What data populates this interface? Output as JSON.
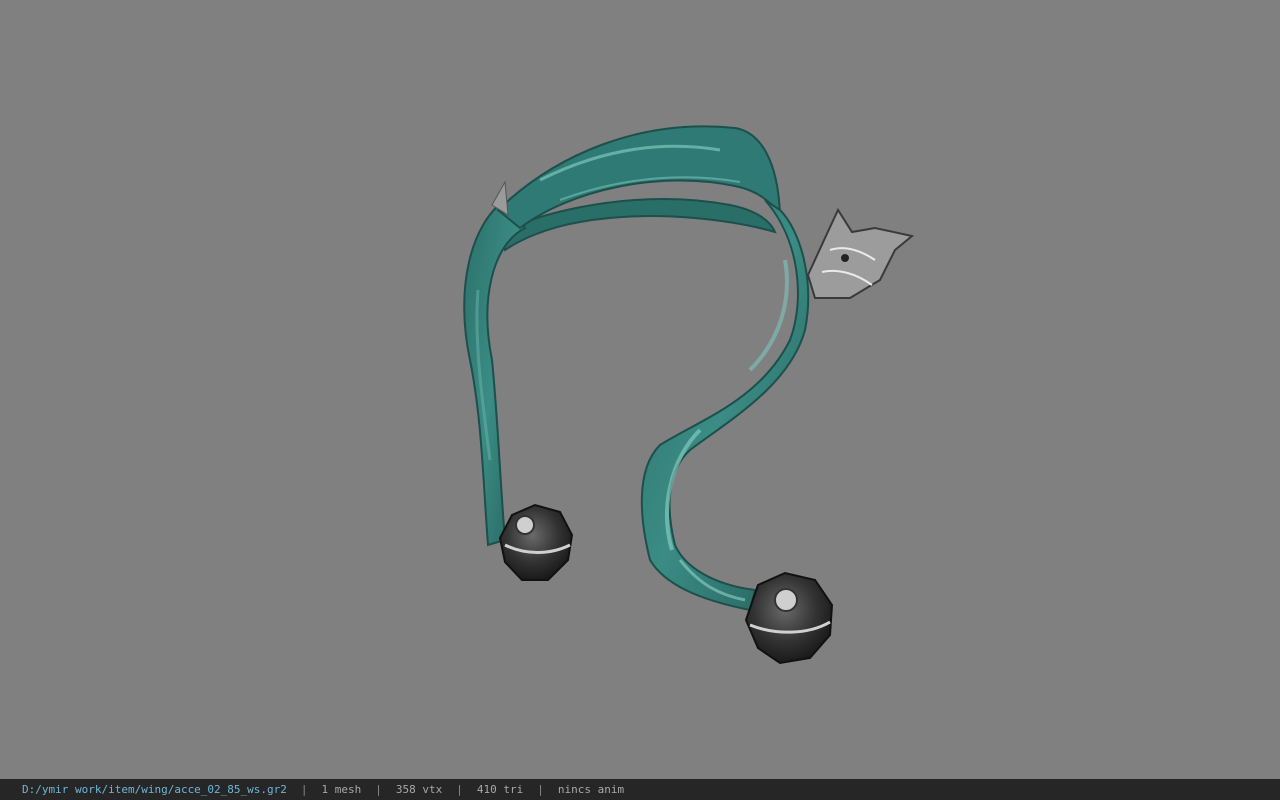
{
  "viewer": {
    "background": "#808080",
    "model": "scarf-accessory-model"
  },
  "statusbar": {
    "file_path": "D:/ymir work/item/wing/acce_02_85_ws.gr2",
    "separator": "|",
    "mesh_count": "1 mesh",
    "vertex_count": "358 vtx",
    "triangle_count": "410 tri",
    "anim": "nincs anim"
  },
  "colors": {
    "scarf": "#2f7a74",
    "scarf_dark": "#1f5a55",
    "scarf_light": "#7cc6bc",
    "metal": "#3a3a3a",
    "silver": "#c9c9c9",
    "path_text": "#6fb6d6"
  }
}
